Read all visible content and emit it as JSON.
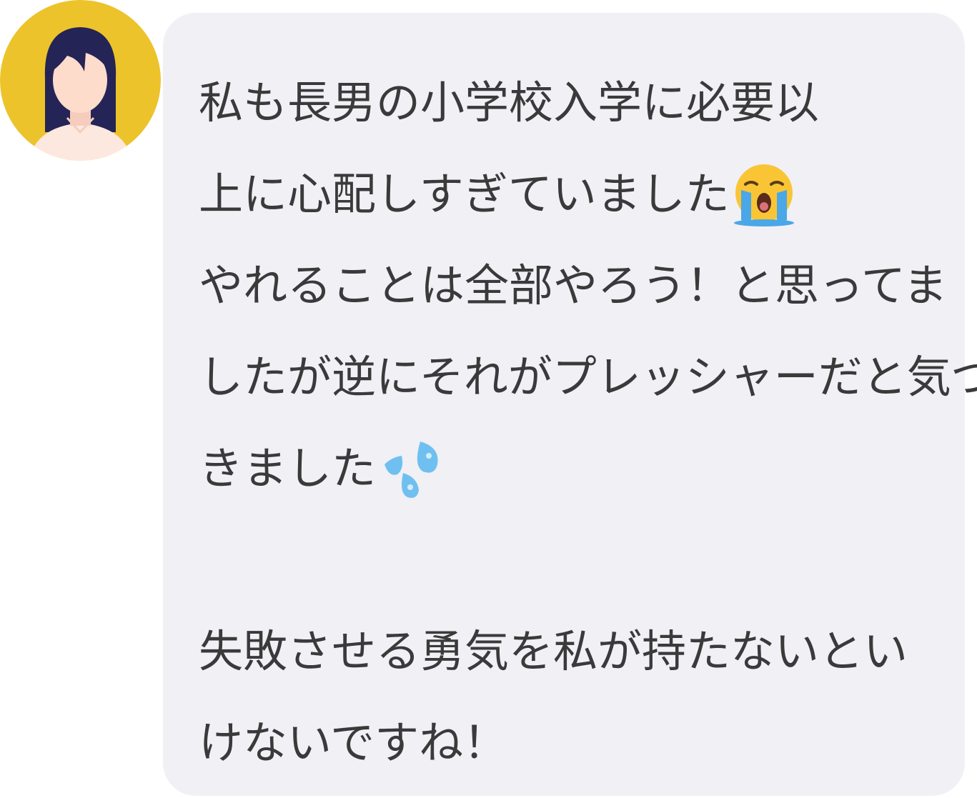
{
  "message": {
    "lines": [
      "私も長男の小学校入学に必要以",
      "上に心配しすぎていました",
      "やれることは全部やろう！と思ってま",
      "したが逆にそれがプレッシャーだと気づ",
      "きました",
      "",
      "失敗させる勇気を私が持たないとい",
      "けないですね！"
    ],
    "emojis": {
      "line_2": "loudly-crying-face-emoji",
      "line_5": "sweat-droplets-emoji"
    }
  },
  "avatar": {
    "icon": "woman-avatar-icon",
    "background_color": "#ecc32a",
    "hair_color": "#242456",
    "skin_color": "#fddccc"
  },
  "bubble": {
    "background_color": "#f1f0f5",
    "text_color": "#3a3a3a"
  }
}
